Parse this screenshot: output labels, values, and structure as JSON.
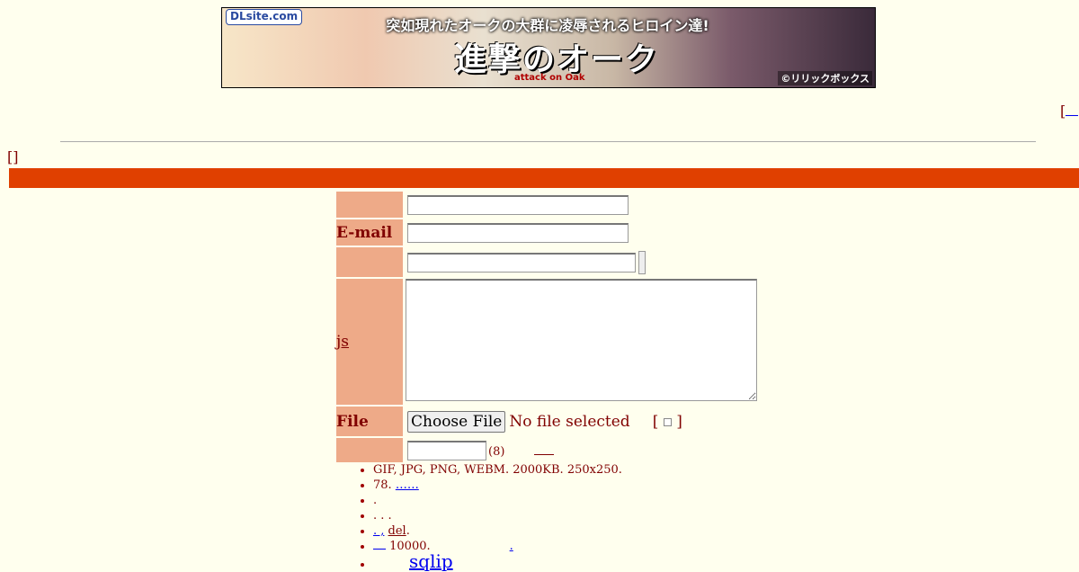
{
  "banner": {
    "logo": "DLsite.com",
    "headline": "突如現れたオークの大群に凌辱されるヒロイン達!",
    "title": "進撃のオーク",
    "subtitle": "attack on Oak",
    "credit": "©リリックボックス"
  },
  "nav": {
    "open_bracket": "[",
    "return_bracket": "[]"
  },
  "form": {
    "email_label": "E-mail",
    "comment_label": "js",
    "file_label": "File",
    "choose_file_label": "Choose File",
    "no_file_text": "No file selected",
    "textonly_open": "[",
    "textonly_close": "]",
    "password_note": "(8)"
  },
  "rules": [
    {
      "text": "GIF, JPG, PNG, WEBM. 2000KB. 250x250."
    },
    {
      "prefix": "78. ",
      "link": "……"
    },
    {
      "text": "."
    },
    {
      "text": ". . ."
    },
    {
      "link": ". ,",
      "mid": " ",
      "link2": "del",
      "suffix": "."
    },
    {
      "suffix": " 10000.",
      "tail": "."
    },
    {
      "link": "sqlip"
    }
  ],
  "colors": {
    "background": "#ffffee",
    "text": "#800000",
    "mode_bar": "#e04000",
    "label_cell": "#eeaa88",
    "link": "#0000ee"
  }
}
